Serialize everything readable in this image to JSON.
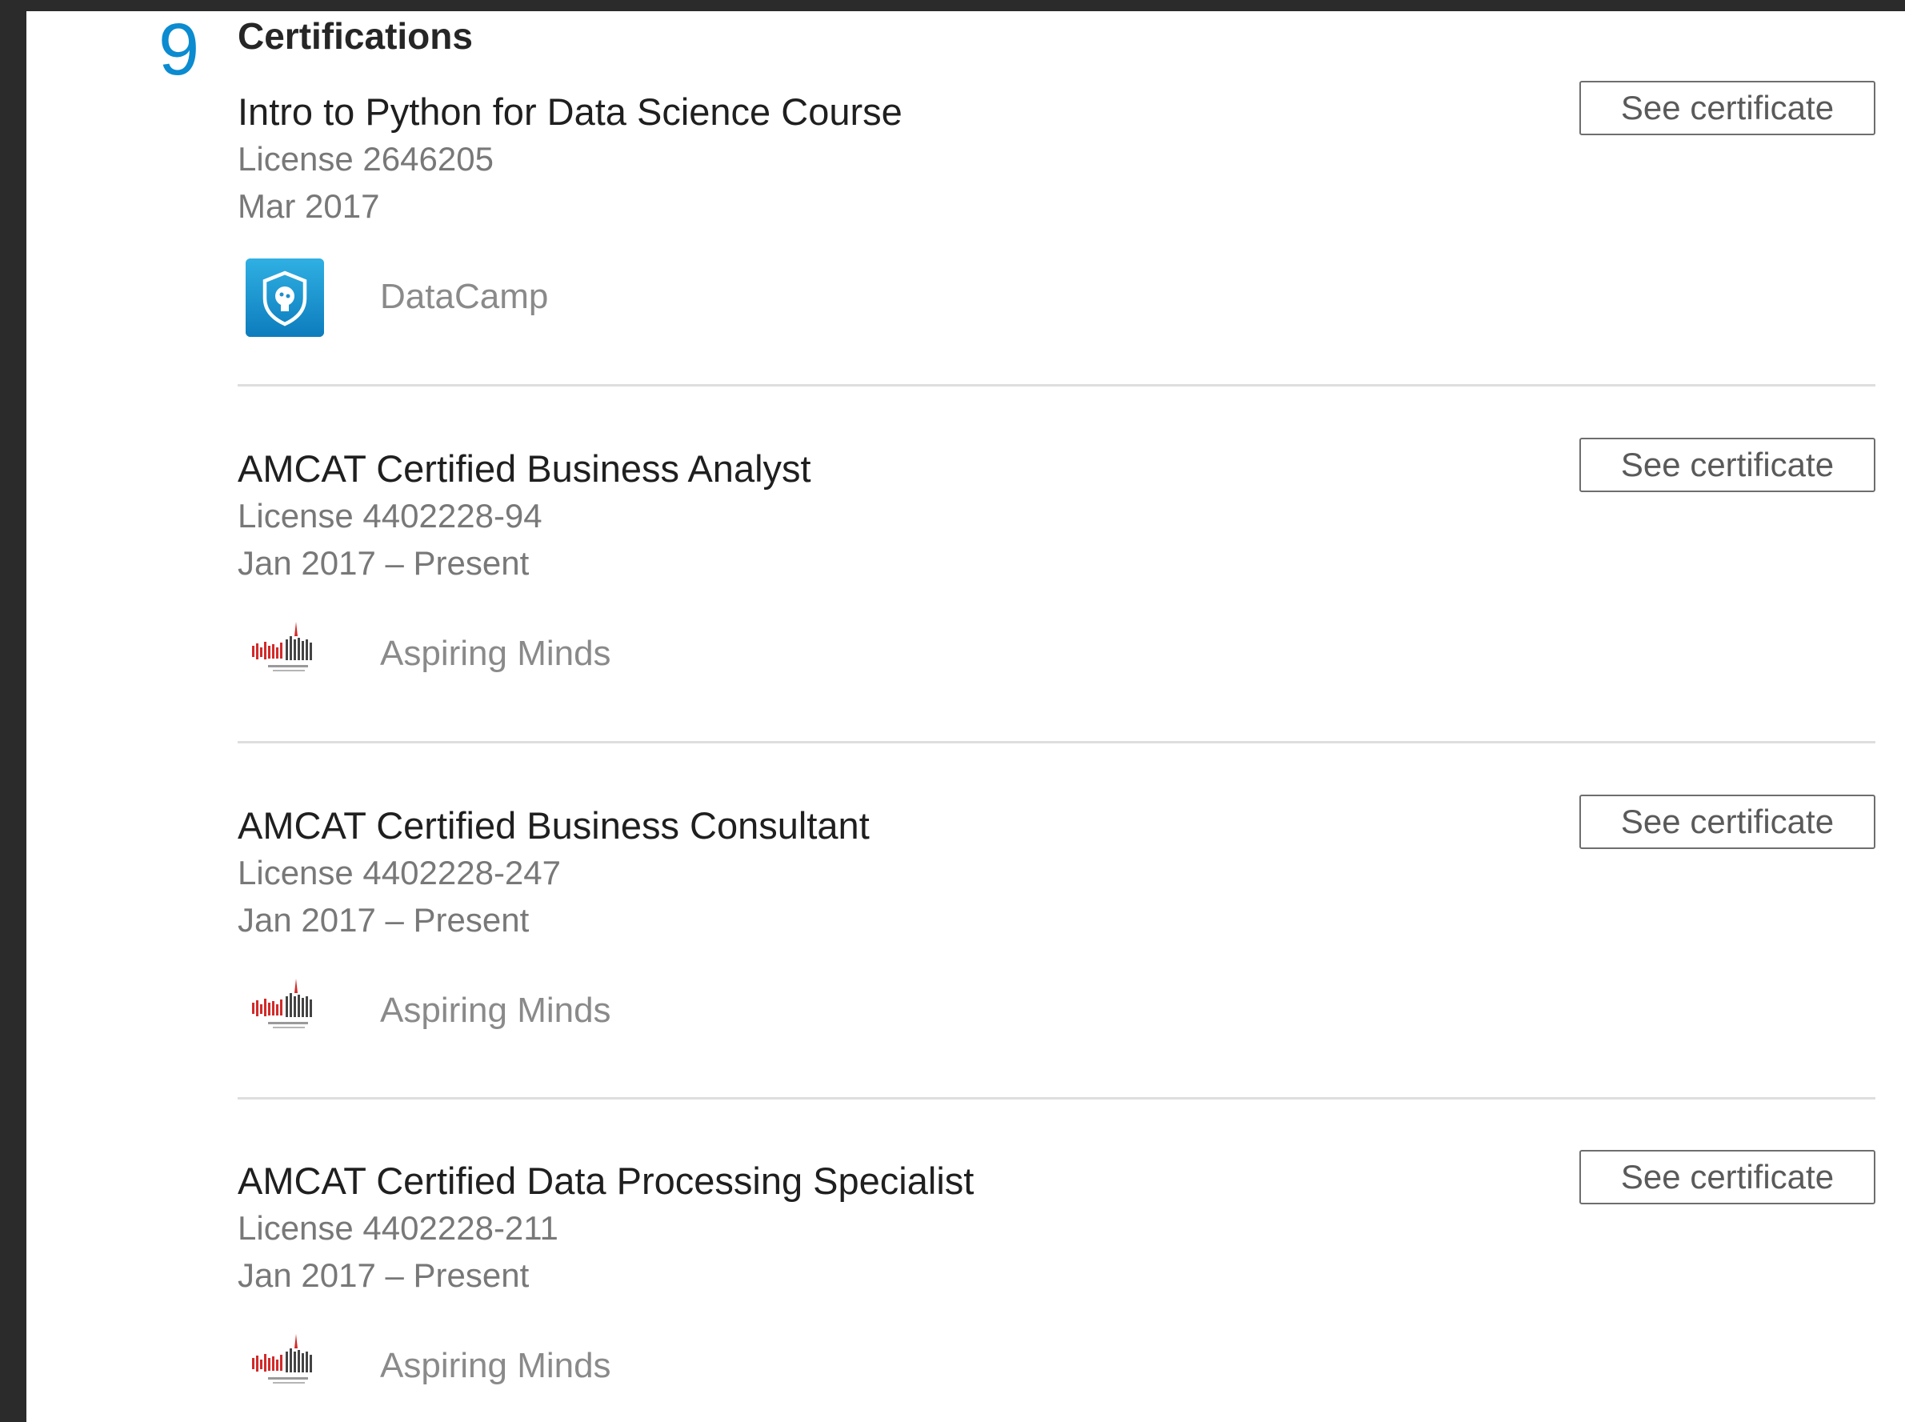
{
  "section": {
    "count": "9",
    "title": "Certifications"
  },
  "certifications": [
    {
      "name": "Intro to Python for Data Science Course",
      "license": "License 2646205",
      "date": "Mar 2017",
      "issuer": "DataCamp",
      "issuer_logo_icon": "datacamp-logo-icon",
      "button_label": "See certificate"
    },
    {
      "name": "AMCAT Certified Business Analyst",
      "license": "License 4402228-94",
      "date": "Jan 2017 – Present",
      "issuer": "Aspiring Minds",
      "issuer_logo_icon": "aspiring-minds-logo-icon",
      "button_label": "See certificate"
    },
    {
      "name": "AMCAT Certified Business Consultant",
      "license": "License 4402228-247",
      "date": "Jan 2017 – Present",
      "issuer": "Aspiring Minds",
      "issuer_logo_icon": "aspiring-minds-logo-icon",
      "button_label": "See certificate"
    },
    {
      "name": "AMCAT Certified Data Processing Specialist",
      "license": "License 4402228-211",
      "date": "Jan 2017 – Present",
      "issuer": "Aspiring Minds",
      "issuer_logo_icon": "aspiring-minds-logo-icon",
      "button_label": "See certificate"
    }
  ],
  "colors": {
    "accent": "#0b8bd0",
    "background_frame": "#2b2b2b",
    "datacamp_logo": "#1a93d0",
    "aspiring_minds_logo": "#d42a2a"
  }
}
